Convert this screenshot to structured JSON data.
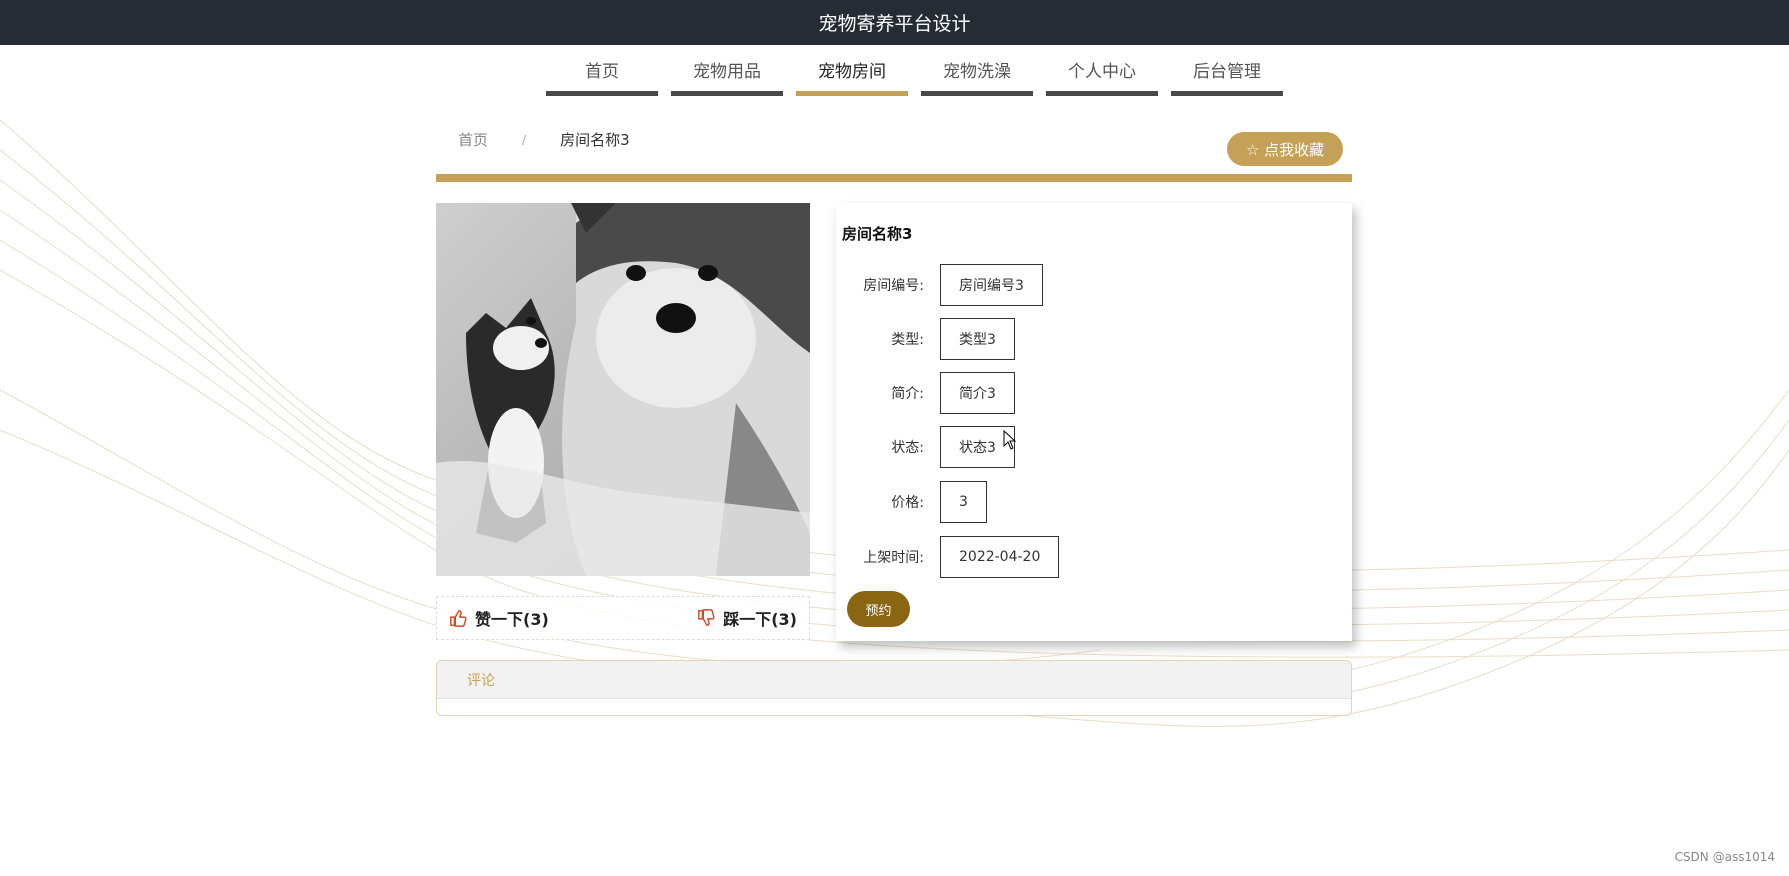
{
  "app": {
    "title": "宠物寄养平台设计"
  },
  "nav": [
    {
      "label": "首页",
      "active": false
    },
    {
      "label": "宠物用品",
      "active": false
    },
    {
      "label": "宠物房间",
      "active": true
    },
    {
      "label": "宠物洗澡",
      "active": false
    },
    {
      "label": "个人中心",
      "active": false
    },
    {
      "label": "后台管理",
      "active": false
    }
  ],
  "breadcrumb": {
    "home": "首页",
    "separator": "/",
    "current": "房间名称3"
  },
  "favorite": {
    "icon": "star-outline-icon",
    "label": "☆ 点我收藏"
  },
  "votes": {
    "like": {
      "icon": "thumbs-up-icon",
      "label": "赞一下(3)"
    },
    "dislike": {
      "icon": "thumbs-down-icon",
      "label": "踩一下(3)"
    }
  },
  "detail": {
    "title": "房间名称3",
    "fields": [
      {
        "label": "房间编号:",
        "value": "房间编号3"
      },
      {
        "label": "类型:",
        "value": "类型3"
      },
      {
        "label": "简介:",
        "value": "简介3"
      },
      {
        "label": "状态:",
        "value": "状态3"
      },
      {
        "label": "价格:",
        "value": "3"
      },
      {
        "label": "上架时间:",
        "value": "2022-04-20"
      }
    ],
    "book_label": "预约"
  },
  "comments": {
    "header": "评论"
  },
  "watermark": "CSDN @ass1014",
  "colors": {
    "topbar": "#262c34",
    "accent": "#c5a157",
    "book_button": "#8a6612"
  }
}
